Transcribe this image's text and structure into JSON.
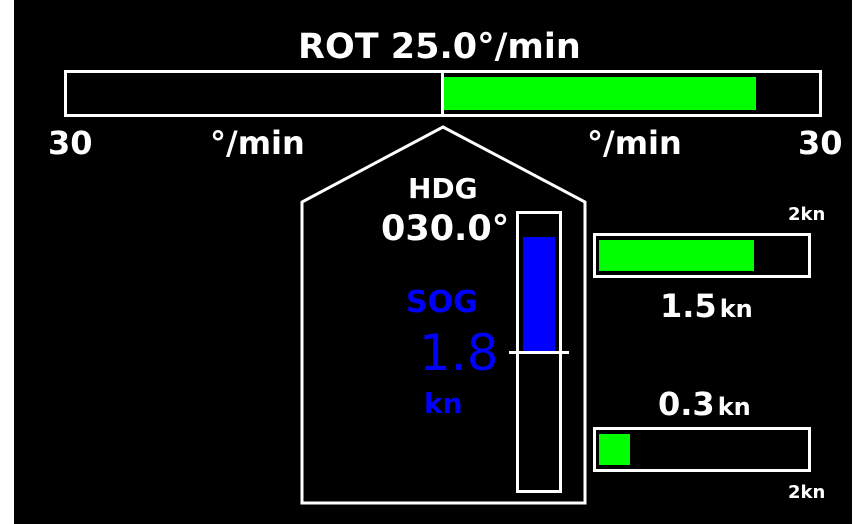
{
  "colors": {
    "background": "#000000",
    "frame": "#ffffff",
    "rot_fill": "#00ff00",
    "sog_color": "#0000ff",
    "stw_fill": "#00ff00"
  },
  "rot": {
    "label": "ROT 25.0°/min",
    "value": 25.0,
    "scale_max": 30,
    "scale_left": "30",
    "scale_right": "30",
    "unit_left": "°/min",
    "unit_right": "°/min"
  },
  "heading": {
    "label": "HDG",
    "value": "030.0°"
  },
  "sog": {
    "label": "SOG",
    "value": "1.8",
    "unit": "kn",
    "fill_fraction": 0.9
  },
  "speed_upper": {
    "value": "1.5",
    "unit": "kn",
    "max_label": "2kn",
    "fraction": 0.75
  },
  "speed_lower": {
    "value": "0.3",
    "unit": "kn",
    "max_label": "2kn",
    "fraction": 0.15
  }
}
